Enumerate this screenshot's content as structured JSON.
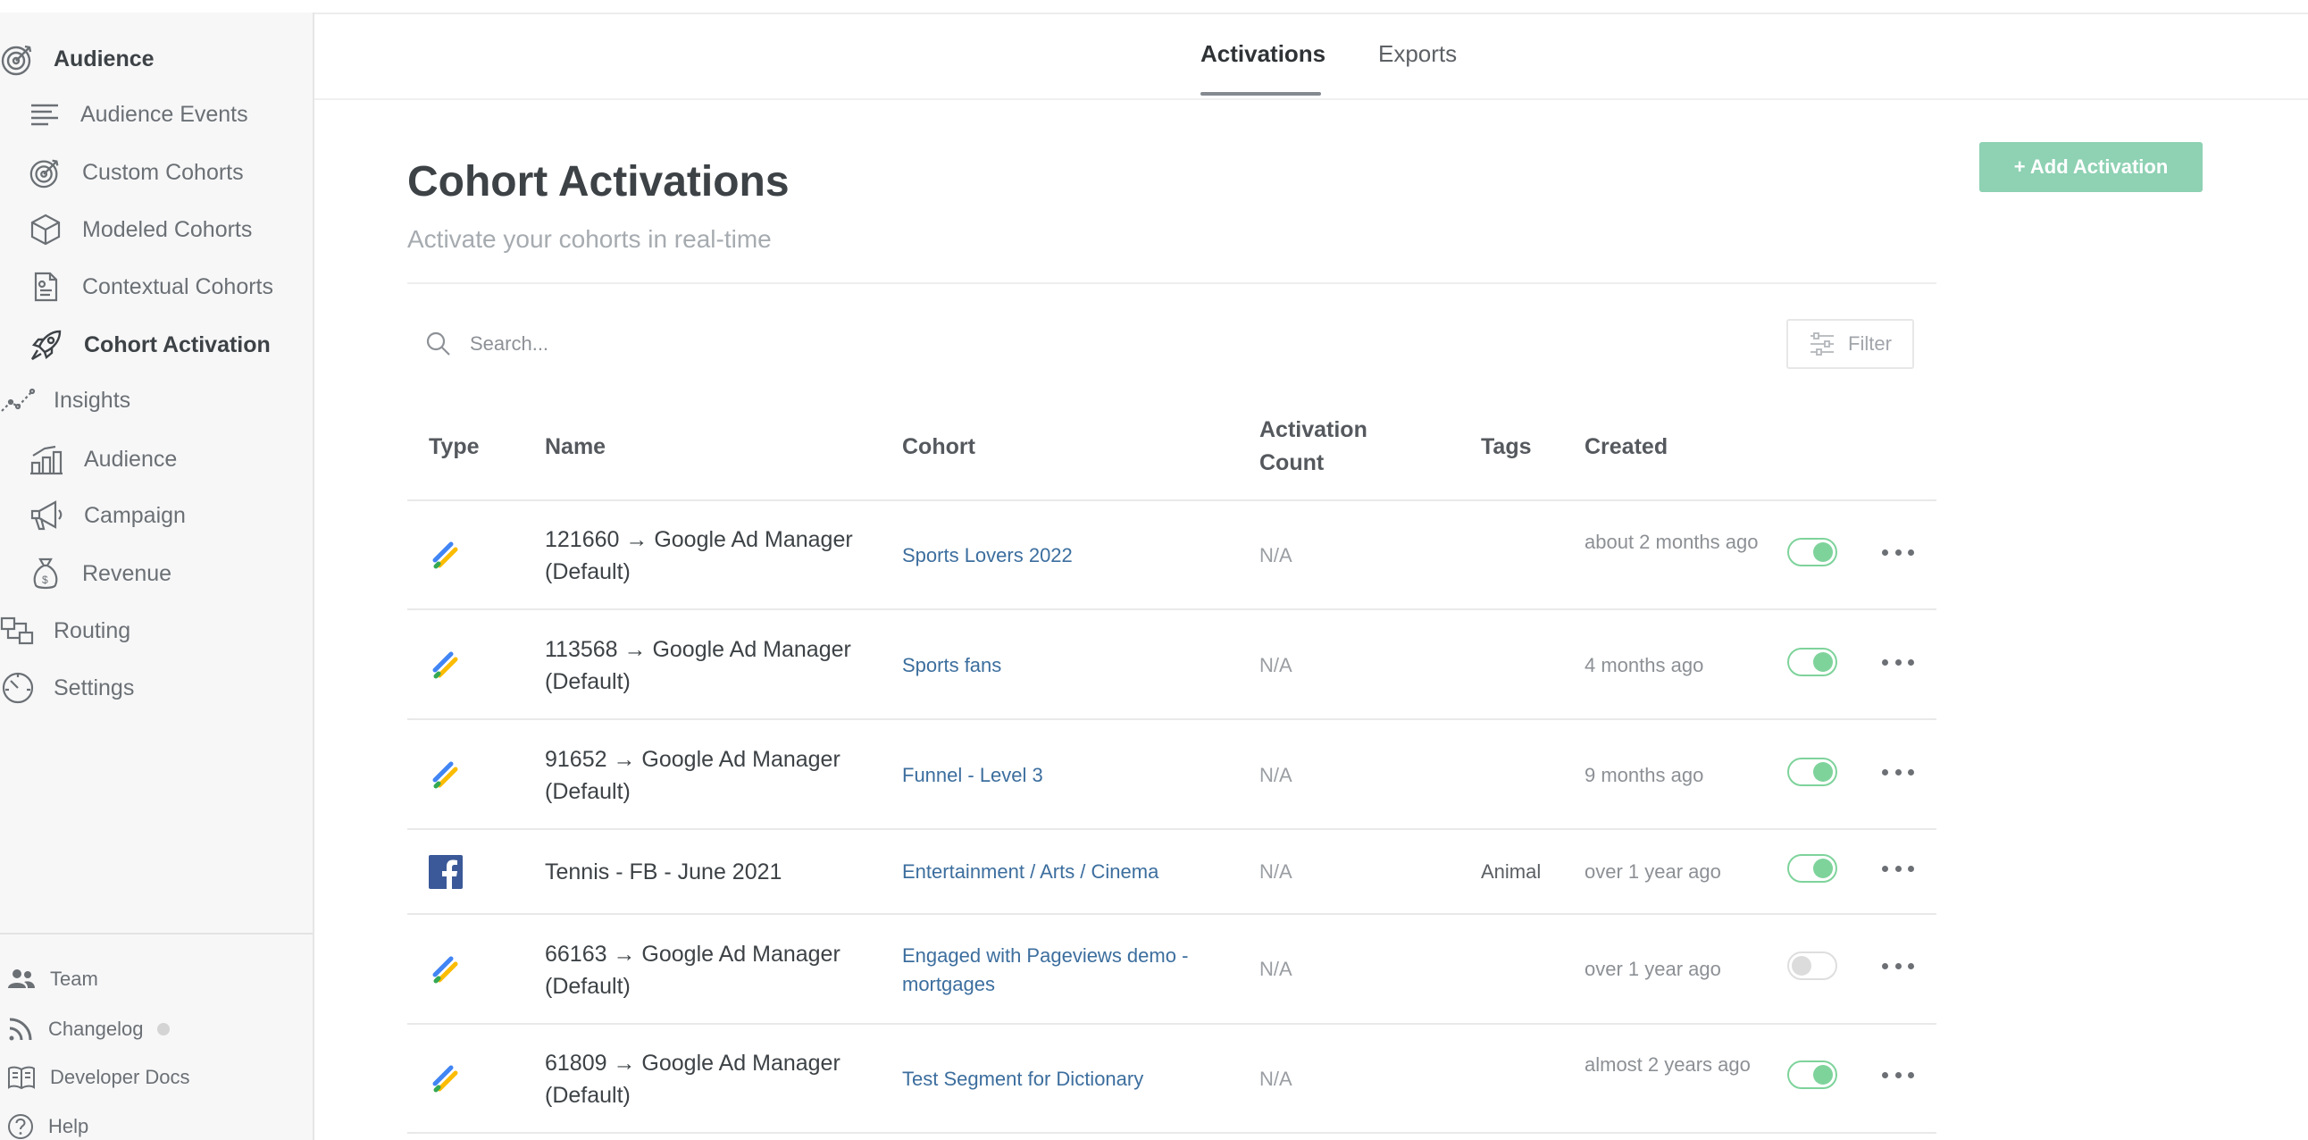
{
  "sidebar": {
    "items": [
      {
        "label": "Audience",
        "icon": "target-icon"
      },
      {
        "label": "Audience Events",
        "icon": "lines-icon"
      },
      {
        "label": "Custom Cohorts",
        "icon": "target-icon"
      },
      {
        "label": "Modeled Cohorts",
        "icon": "cube-icon"
      },
      {
        "label": "Contextual Cohorts",
        "icon": "document-icon"
      },
      {
        "label": "Cohort Activation",
        "icon": "rocket-icon"
      },
      {
        "label": "Insights",
        "icon": "trend-icon"
      },
      {
        "label": "Audience",
        "icon": "bar-people-icon"
      },
      {
        "label": "Campaign",
        "icon": "megaphone-icon"
      },
      {
        "label": "Revenue",
        "icon": "money-bag-icon"
      },
      {
        "label": "Routing",
        "icon": "routing-icon"
      },
      {
        "label": "Settings",
        "icon": "gauge-icon"
      }
    ],
    "bottom": [
      {
        "label": "Team",
        "icon": "people-icon"
      },
      {
        "label": "Changelog",
        "icon": "rss-icon"
      },
      {
        "label": "Developer Docs",
        "icon": "book-icon"
      },
      {
        "label": "Help",
        "icon": "help-icon"
      }
    ]
  },
  "tabs": [
    {
      "label": "Activations",
      "active": true
    },
    {
      "label": "Exports",
      "active": false
    }
  ],
  "header": {
    "title": "Cohort Activations",
    "subtitle": "Activate your cohorts in real-time",
    "add_button": "+ Add Activation"
  },
  "search": {
    "placeholder": "Search..."
  },
  "filter": {
    "label": "Filter"
  },
  "table": {
    "headers": {
      "type": "Type",
      "name": "Name",
      "cohort": "Cohort",
      "activation_count_1": "Activation",
      "activation_count_2": "Count",
      "tags": "Tags",
      "created": "Created"
    },
    "rows": [
      {
        "type_icon": "google-ad-manager-icon",
        "name": "121660 → Google Ad Manager (Default)",
        "cohort": "Sports Lovers 2022",
        "count": "N/A",
        "tags": "",
        "created": "about 2 months ago",
        "enabled": true
      },
      {
        "type_icon": "google-ad-manager-icon",
        "name": "113568 → Google Ad Manager (Default)",
        "cohort": "Sports fans",
        "count": "N/A",
        "tags": "",
        "created": "4 months ago",
        "enabled": true
      },
      {
        "type_icon": "google-ad-manager-icon",
        "name": "91652 → Google Ad Manager (Default)",
        "cohort": "Funnel - Level 3",
        "count": "N/A",
        "tags": "",
        "created": "9 months ago",
        "enabled": true
      },
      {
        "type_icon": "facebook-icon",
        "name": "Tennis - FB - June 2021",
        "cohort": "Entertainment / Arts / Cinema",
        "count": "N/A",
        "tags": "Animal",
        "created": "over 1 year ago",
        "enabled": true
      },
      {
        "type_icon": "google-ad-manager-icon",
        "name": "66163 → Google Ad Manager (Default)",
        "cohort": "Engaged with Pageviews demo - mortgages",
        "count": "N/A",
        "tags": "",
        "created": "over 1 year ago",
        "enabled": false
      },
      {
        "type_icon": "google-ad-manager-icon",
        "name": "61809 → Google Ad Manager (Default)",
        "cohort": "Test Segment for Dictionary",
        "count": "N/A",
        "tags": "",
        "created": "almost 2 years ago",
        "enabled": true
      }
    ]
  },
  "colors": {
    "accent_green": "#8ed1b3",
    "toggle_on": "#7ed39b",
    "link_blue": "#3c6e9e",
    "facebook_blue": "#3b5998"
  }
}
